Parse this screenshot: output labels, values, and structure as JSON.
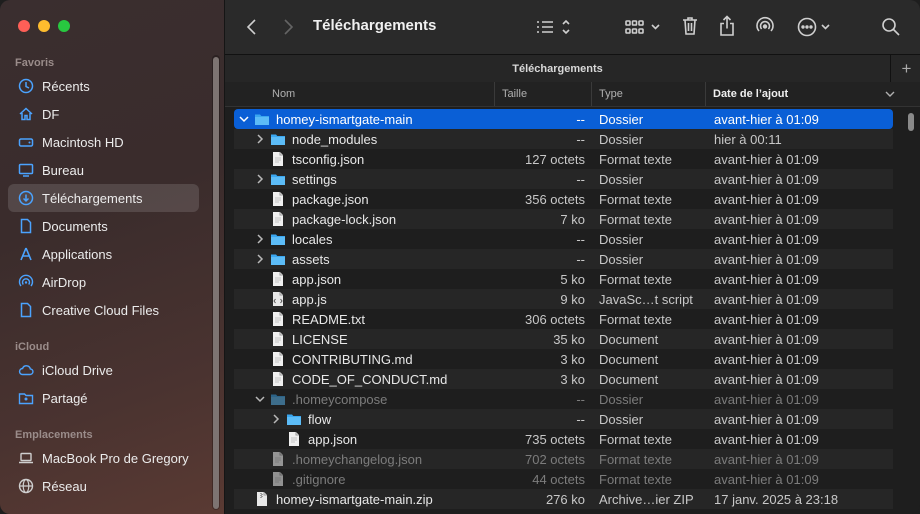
{
  "window": {
    "title": "Téléchargements"
  },
  "tab": {
    "label": "Téléchargements"
  },
  "sidebar": {
    "sections": [
      {
        "title": "Favoris"
      },
      {
        "title": "iCloud"
      },
      {
        "title": "Emplacements"
      }
    ],
    "items": [
      {
        "label": "Récents",
        "icon": "clock-icon"
      },
      {
        "label": "DF",
        "icon": "home-icon"
      },
      {
        "label": "Macintosh HD",
        "icon": "harddrive-icon"
      },
      {
        "label": "Bureau",
        "icon": "desktop-icon"
      },
      {
        "label": "Téléchargements",
        "icon": "download-icon",
        "active": true
      },
      {
        "label": "Documents",
        "icon": "document-icon"
      },
      {
        "label": "Applications",
        "icon": "applications-icon"
      },
      {
        "label": "AirDrop",
        "icon": "airdrop-icon"
      },
      {
        "label": "Creative Cloud Files",
        "icon": "file-icon"
      },
      {
        "label": "iCloud Drive",
        "icon": "cloud-icon"
      },
      {
        "label": "Partagé",
        "icon": "shared-folder-icon"
      },
      {
        "label": "MacBook Pro de Gregory",
        "icon": "laptop-icon"
      },
      {
        "label": "Réseau",
        "icon": "globe-icon"
      }
    ]
  },
  "columns": {
    "name": "Nom",
    "size": "Taille",
    "kind": "Type",
    "date": "Date de l’ajout"
  },
  "rows": [
    {
      "name": "homey-ismartgate-main",
      "size": "--",
      "kind": "Dossier",
      "date": "avant-hier à 01:09",
      "type": "folder",
      "depth": 0,
      "disclosure": "open",
      "selected": true
    },
    {
      "name": "node_modules",
      "size": "--",
      "kind": "Dossier",
      "date": "hier à 00:11",
      "type": "folder",
      "depth": 1,
      "disclosure": "closed"
    },
    {
      "name": "tsconfig.json",
      "size": "127 octets",
      "kind": "Format texte",
      "date": "avant-hier à 01:09",
      "type": "file",
      "depth": 1
    },
    {
      "name": "settings",
      "size": "--",
      "kind": "Dossier",
      "date": "avant-hier à 01:09",
      "type": "folder",
      "depth": 1,
      "disclosure": "closed"
    },
    {
      "name": "package.json",
      "size": "356 octets",
      "kind": "Format texte",
      "date": "avant-hier à 01:09",
      "type": "file",
      "depth": 1
    },
    {
      "name": "package-lock.json",
      "size": "7 ko",
      "kind": "Format texte",
      "date": "avant-hier à 01:09",
      "type": "file",
      "depth": 1
    },
    {
      "name": "locales",
      "size": "--",
      "kind": "Dossier",
      "date": "avant-hier à 01:09",
      "type": "folder",
      "depth": 1,
      "disclosure": "closed"
    },
    {
      "name": "assets",
      "size": "--",
      "kind": "Dossier",
      "date": "avant-hier à 01:09",
      "type": "folder",
      "depth": 1,
      "disclosure": "closed"
    },
    {
      "name": "app.json",
      "size": "5 ko",
      "kind": "Format texte",
      "date": "avant-hier à 01:09",
      "type": "file",
      "depth": 1
    },
    {
      "name": "app.js",
      "size": "9 ko",
      "kind": "JavaSc…t script",
      "date": "avant-hier à 01:09",
      "type": "script",
      "depth": 1
    },
    {
      "name": "README.txt",
      "size": "306 octets",
      "kind": "Format texte",
      "date": "avant-hier à 01:09",
      "type": "file",
      "depth": 1
    },
    {
      "name": "LICENSE",
      "size": "35 ko",
      "kind": "Document",
      "date": "avant-hier à 01:09",
      "type": "file",
      "depth": 1
    },
    {
      "name": "CONTRIBUTING.md",
      "size": "3 ko",
      "kind": "Document",
      "date": "avant-hier à 01:09",
      "type": "file",
      "depth": 1
    },
    {
      "name": "CODE_OF_CONDUCT.md",
      "size": "3 ko",
      "kind": "Document",
      "date": "avant-hier à 01:09",
      "type": "file",
      "depth": 1
    },
    {
      "name": ".homeycompose",
      "size": "--",
      "kind": "Dossier",
      "date": "avant-hier à 01:09",
      "type": "folder",
      "depth": 1,
      "disclosure": "open",
      "dim": true
    },
    {
      "name": "flow",
      "size": "--",
      "kind": "Dossier",
      "date": "avant-hier à 01:09",
      "type": "folder",
      "depth": 2,
      "disclosure": "closed"
    },
    {
      "name": "app.json",
      "size": "735 octets",
      "kind": "Format texte",
      "date": "avant-hier à 01:09",
      "type": "file",
      "depth": 2
    },
    {
      "name": ".homeychangelog.json",
      "size": "702 octets",
      "kind": "Format texte",
      "date": "avant-hier à 01:09",
      "type": "file",
      "depth": 1,
      "dim": true
    },
    {
      "name": ".gitignore",
      "size": "44 octets",
      "kind": "Format texte",
      "date": "avant-hier à 01:09",
      "type": "file",
      "depth": 1,
      "dim": true
    },
    {
      "name": "homey-ismartgate-main.zip",
      "size": "276 ko",
      "kind": "Archive…ier ZIP",
      "date": "17 janv. 2025 à 23:18",
      "type": "zip",
      "depth": 0
    }
  ],
  "colors": {
    "accent": "#0a5fd6",
    "folder": "#3aa7f0",
    "sidebar_icon": "#4ba3ff"
  }
}
